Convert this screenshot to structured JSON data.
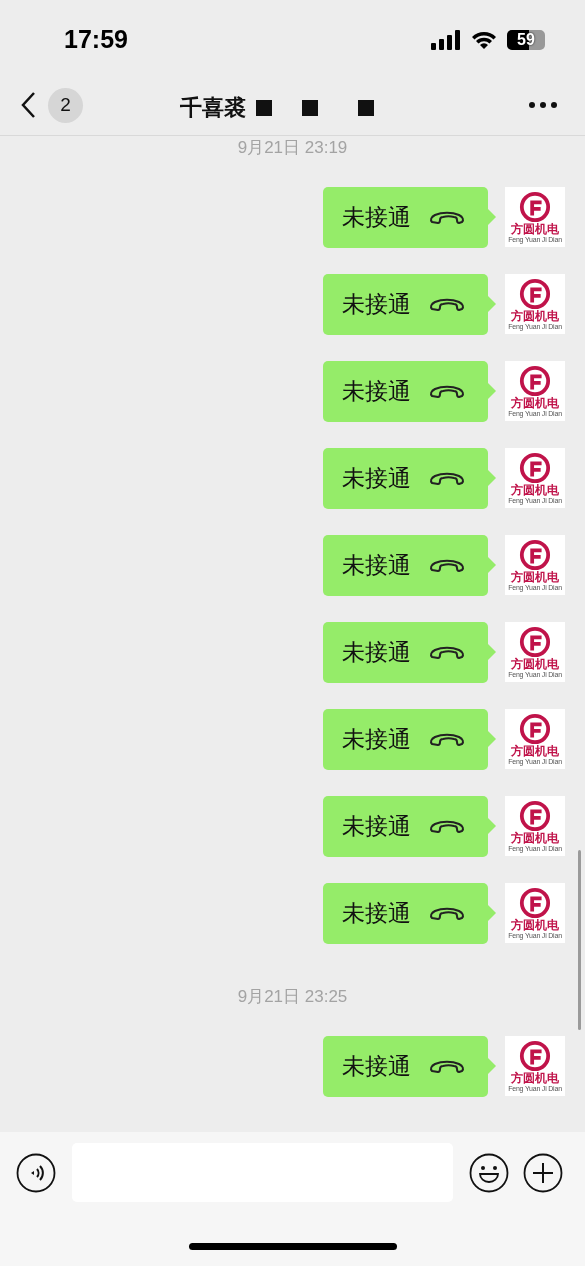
{
  "status_bar": {
    "time": "17:59",
    "battery": "59"
  },
  "header": {
    "back_count": "2",
    "title": "千喜裘"
  },
  "sections": [
    {
      "time": "9月21日 23:19",
      "messages": [
        {
          "text": "未接通",
          "avatar_name": "方圆机电",
          "avatar_subtitle": "Feng Yuan Ji Dian"
        },
        {
          "text": "未接通",
          "avatar_name": "方圆机电",
          "avatar_subtitle": "Feng Yuan Ji Dian"
        },
        {
          "text": "未接通",
          "avatar_name": "方圆机电",
          "avatar_subtitle": "Feng Yuan Ji Dian"
        },
        {
          "text": "未接通",
          "avatar_name": "方圆机电",
          "avatar_subtitle": "Feng Yuan Ji Dian"
        },
        {
          "text": "未接通",
          "avatar_name": "方圆机电",
          "avatar_subtitle": "Feng Yuan Ji Dian"
        },
        {
          "text": "未接通",
          "avatar_name": "方圆机电",
          "avatar_subtitle": "Feng Yuan Ji Dian"
        },
        {
          "text": "未接通",
          "avatar_name": "方圆机电",
          "avatar_subtitle": "Feng Yuan Ji Dian"
        },
        {
          "text": "未接通",
          "avatar_name": "方圆机电",
          "avatar_subtitle": "Feng Yuan Ji Dian"
        },
        {
          "text": "未接通",
          "avatar_name": "方圆机电",
          "avatar_subtitle": "Feng Yuan Ji Dian"
        }
      ]
    },
    {
      "time": "9月21日 23:25",
      "messages": [
        {
          "text": "未接通",
          "avatar_name": "方圆机电",
          "avatar_subtitle": "Feng Yuan Ji Dian"
        }
      ]
    }
  ]
}
